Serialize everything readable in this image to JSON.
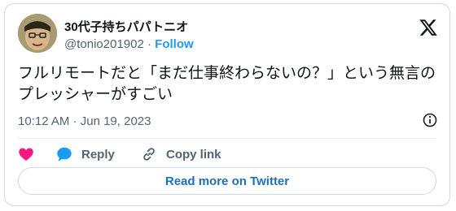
{
  "author": {
    "display_name": "30代子持ちパパトニオ",
    "handle": "@tonio201902",
    "separator": " · ",
    "follow_label": "Follow",
    "avatar_icon": "cartoon-face-avatar"
  },
  "brand_icon": "x-logo-icon",
  "tweet": {
    "text": "フルリモートだと「まだ仕事終わらないの？」という無言のプレッシャーがすごい",
    "time": "10:12 AM",
    "date_separator": " · ",
    "date": "Jun 19, 2023"
  },
  "actions": {
    "like_icon": "heart-icon",
    "reply_label": "Reply",
    "copy_label": "Copy link"
  },
  "read_more_label": "Read more on Twitter",
  "colors": {
    "accent": "#1d9bf0",
    "heart": "#f91880",
    "secondary_text": "#536471",
    "border": "#cfd9de"
  }
}
